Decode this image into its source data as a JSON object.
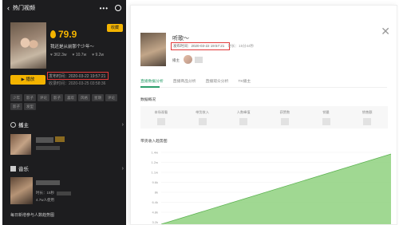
{
  "phone": {
    "title": "热门视频",
    "price": "79.9",
    "collect_label": "收藏",
    "song_line": "我还是从前那个少年～",
    "stats": [
      "362.3w",
      "10.7w",
      "9.2w"
    ],
    "play_label": "▶ 播放",
    "pub_time": "发布时间：2020-03-22 19:57:21",
    "record_time": "收录时间：2020-03-25 03:58:36",
    "tags": [
      "少年",
      "影子",
      "评论",
      "影子",
      "喜欢",
      "风格",
      "星期",
      "评论",
      "影子",
      "发型"
    ],
    "owner_section": "播主",
    "music_section": "音乐",
    "music_duration": "时长：15秒",
    "music_usage": "4.7w人使用",
    "footer": "每日新增参与人数趋势图"
  },
  "dialog": {
    "title": "听歌～",
    "pub_time": "发布时间：2020-03-22 19:57:21",
    "duration_label": "时长：15分44秒",
    "owner_label": "播主",
    "tabs": [
      "直播数据分析",
      "直播商品分析",
      "直播观众分析",
      "TK播主"
    ],
    "summary_title": "数据概况",
    "metrics": [
      "本场观看",
      "带货收入",
      "人数峰值",
      "获赞数",
      "销量",
      "销售额"
    ],
    "chart_title": "带货收入趋势图",
    "y_ticks": [
      "1.4w",
      "1.2w",
      "1.1w",
      "9.6k",
      "8k",
      "6.4k",
      "4.8k",
      "3.2k"
    ]
  },
  "colors": {
    "accent": "#f4b400",
    "highlight": "#e23a3a",
    "green": "#2c9f6b",
    "area": "#8fd17f"
  }
}
